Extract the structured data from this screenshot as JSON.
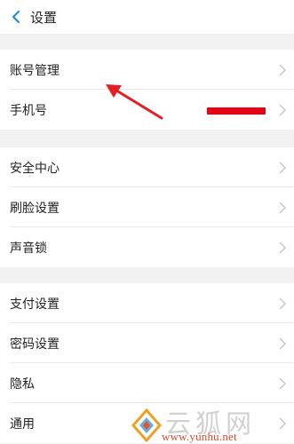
{
  "header": {
    "title": "设置"
  },
  "groups": [
    {
      "items": [
        {
          "label": "账号管理"
        },
        {
          "label": "手机号"
        }
      ]
    },
    {
      "items": [
        {
          "label": "安全中心"
        },
        {
          "label": "刷脸设置"
        },
        {
          "label": "声音锁"
        }
      ]
    },
    {
      "items": [
        {
          "label": "支付设置"
        },
        {
          "label": "密码设置"
        },
        {
          "label": "隐私"
        },
        {
          "label": "通用"
        }
      ]
    }
  ],
  "colors": {
    "accent": "#1a88e6",
    "annotation": "#e31e24",
    "redaction": "#e60012",
    "background": "#f2f2f2"
  },
  "watermark": {
    "chinese": "云狐网",
    "url": "www.yunhu.net"
  }
}
